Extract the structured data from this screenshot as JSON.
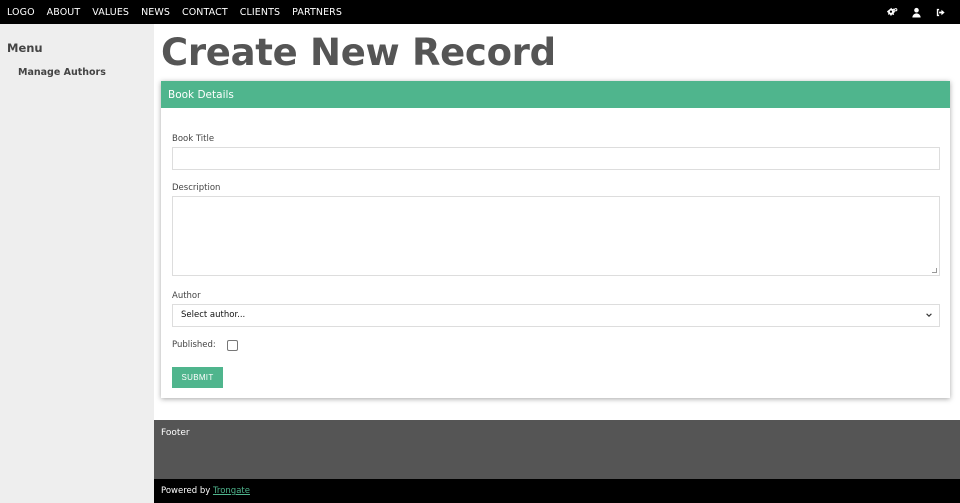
{
  "topnav": {
    "items": [
      "LOGO",
      "ABOUT",
      "VALUES",
      "NEWS",
      "CONTACT",
      "CLIENTS",
      "PARTNERS"
    ],
    "icons": [
      "settings-icon",
      "user-icon",
      "logout-icon"
    ]
  },
  "sidebar": {
    "heading": "Menu",
    "items": [
      {
        "label": "Manage Authors"
      }
    ]
  },
  "main": {
    "title": "Create New Record"
  },
  "form": {
    "header": "Book Details",
    "book_title_label": "Book Title",
    "book_title_value": "",
    "description_label": "Description",
    "description_value": "",
    "author_label": "Author",
    "author_selected": "Select author...",
    "published_label": "Published:",
    "published_checked": false,
    "submit_label": "SUBMIT"
  },
  "footer": {
    "text": "Footer",
    "powered_prefix": "Powered by",
    "powered_link": "Trongate"
  },
  "colors": {
    "accent": "#4fb58d",
    "topbar": "#000000",
    "sidebar_bg": "#eeeeee",
    "footer_bg": "#555555"
  }
}
